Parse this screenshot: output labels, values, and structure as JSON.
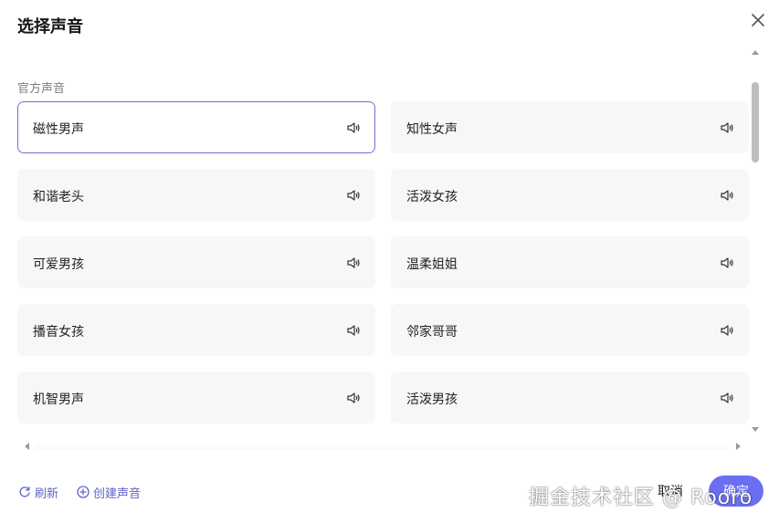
{
  "dialog": {
    "title": "选择声音",
    "close_icon": "close-icon"
  },
  "section": {
    "label": "官方声音"
  },
  "voices": [
    {
      "label": "磁性男声",
      "selected": true
    },
    {
      "label": "知性女声",
      "selected": false
    },
    {
      "label": "和谐老头",
      "selected": false
    },
    {
      "label": "活泼女孩",
      "selected": false
    },
    {
      "label": "可爱男孩",
      "selected": false
    },
    {
      "label": "温柔姐姐",
      "selected": false
    },
    {
      "label": "播音女孩",
      "selected": false
    },
    {
      "label": "邻家哥哥",
      "selected": false
    },
    {
      "label": "机智男声",
      "selected": false
    },
    {
      "label": "活泼男孩",
      "selected": false
    }
  ],
  "footer": {
    "refresh_label": "刷新",
    "create_label": "创建声音",
    "cancel_label": "取消",
    "ok_label": "确定"
  },
  "watermark": "掘金技术社区 @ Rooro",
  "colors": {
    "accent": "#6a6ef0",
    "link": "#5f63c8",
    "selected_border": "#6f73d2",
    "card_bg": "#f6f7f9"
  }
}
